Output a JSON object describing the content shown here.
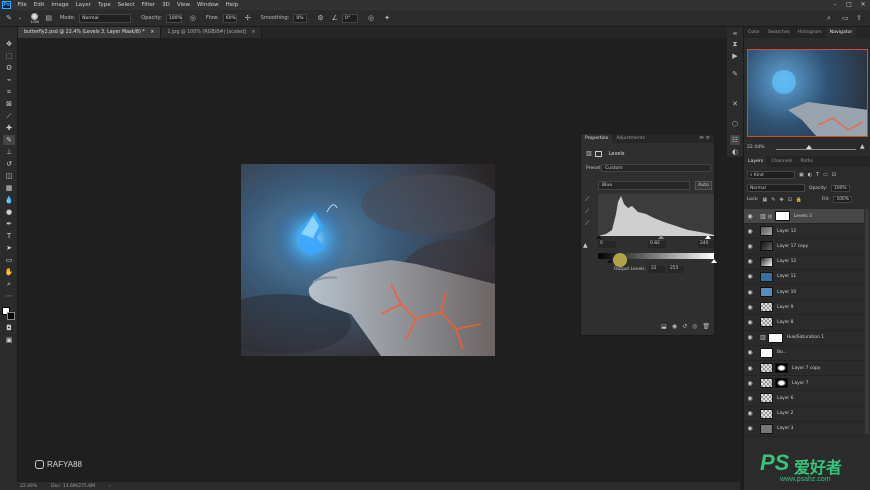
{
  "menu": [
    "File",
    "Edit",
    "Image",
    "Layer",
    "Type",
    "Select",
    "Filter",
    "3D",
    "View",
    "Window",
    "Help"
  ],
  "options": {
    "brush_size": "1000",
    "mode_label": "Mode:",
    "mode_value": "Normal",
    "opacity_label": "Opacity:",
    "opacity_value": "100%",
    "flow_label": "Flow:",
    "flow_value": "60%",
    "smoothing_label": "Smoothing:",
    "smoothing_value": "0%",
    "angle_value": "0°"
  },
  "doc_tabs": [
    {
      "label": "butterfly2.psd @ 22.4% (Levels 3, Layer Mask/8) *"
    },
    {
      "label": "1.jpg @ 100% (RGB/8#) [scaled]"
    }
  ],
  "status": {
    "zoom": "22.49%",
    "doc": "Doc: 13.6M/275.6M"
  },
  "watermark": "RAFYA88",
  "properties": {
    "tabs": [
      "Properties",
      "Adjustments"
    ],
    "title": "Levels",
    "preset_label": "Preset:",
    "preset_value": "Custom",
    "channel_value": "Blue",
    "auto_label": "Auto",
    "input_black": "0",
    "input_gamma": "0.82",
    "input_white": "240",
    "output_label": "Output Levels:",
    "output_black": "22",
    "output_white": "255"
  },
  "right_tabs": [
    "Color",
    "Swatches",
    "Histogram",
    "Navigator"
  ],
  "navigator": {
    "zoom": "22.44%"
  },
  "layers_tabs": [
    "Layers",
    "Channels",
    "Paths"
  ],
  "layers_filter": "Kind",
  "blend_mode": "Normal",
  "opacity_label": "Opacity:",
  "opacity_value": "100%",
  "lock_label": "Lock:",
  "fill_label": "Fill:",
  "fill_value": "100%",
  "layers": [
    {
      "name": "Levels 3",
      "thumb": "adj",
      "mask": "white",
      "selected": true
    },
    {
      "name": "Layer 12",
      "thumb": "mixed"
    },
    {
      "name": "Layer 17 copy",
      "thumb": "dark"
    },
    {
      "name": "Layer 12",
      "thumb": "mixed2"
    },
    {
      "name": "Layer 11",
      "thumb": "blue"
    },
    {
      "name": "Layer 10",
      "thumb": "blue2"
    },
    {
      "name": "Layer 9",
      "thumb": "checker"
    },
    {
      "name": "Layer 8",
      "thumb": "checker"
    },
    {
      "name": "Hue/Saturation 1",
      "thumb": "adj",
      "mask": "white"
    },
    {
      "name": "Bo...",
      "thumb": "white"
    },
    {
      "name": "Layer 7 copy",
      "thumb": "checker",
      "mask": "black"
    },
    {
      "name": "Layer 7",
      "thumb": "checker",
      "mask": "black"
    },
    {
      "name": "Layer 6",
      "thumb": "checker"
    },
    {
      "name": "Layer 2",
      "thumb": "checker"
    },
    {
      "name": "Layer 3",
      "thumb": "grey"
    }
  ],
  "psahz": {
    "brand": "PS",
    "cn": "爱好者",
    "url": "www.psahz.com"
  }
}
